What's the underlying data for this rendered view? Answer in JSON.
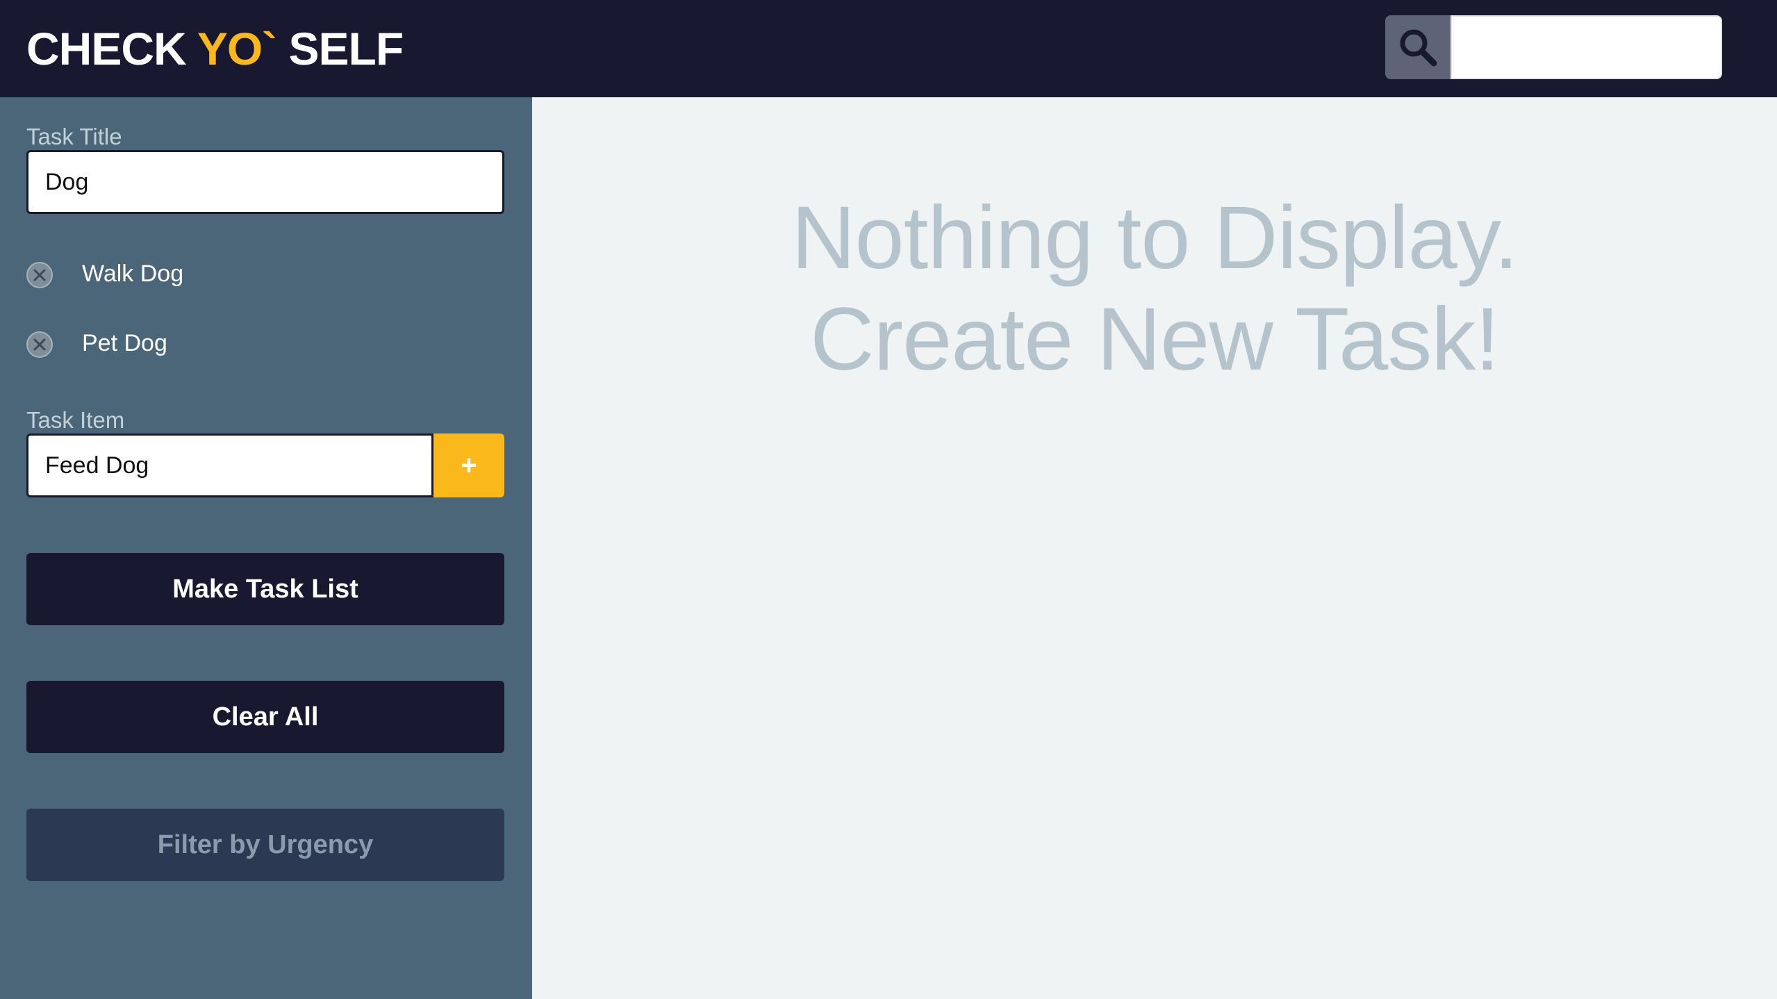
{
  "header": {
    "logo_part1": "CHECK ",
    "logo_accent": "YO`",
    "logo_part2": " SELF",
    "search_placeholder": "",
    "search_icon": "magnifier-icon"
  },
  "sidebar": {
    "task_title_label": "Task Title",
    "task_title_value": "Dog",
    "task_items": [
      {
        "label": "Walk Dog"
      },
      {
        "label": "Pet Dog"
      }
    ],
    "task_item_label": "Task Item",
    "task_item_value": "Feed Dog",
    "add_button": "+",
    "make_task_list": "Make Task List",
    "clear_all": "Clear All",
    "filter_by_urgency": "Filter by Urgency"
  },
  "main": {
    "empty_line1": "Nothing to Display.",
    "empty_line2": "Create New Task!"
  },
  "colors": {
    "header_bg": "#181830",
    "accent": "#fbb81a",
    "sidebar_bg": "#4a6678",
    "main_bg": "#eff3f4"
  }
}
